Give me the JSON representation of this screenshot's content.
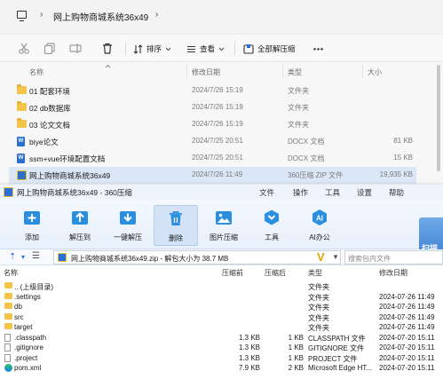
{
  "explorer": {
    "breadcrumb_chevron": "›",
    "folder_name": "网上购物商城系统36x49",
    "toolbar": {
      "sort_label": "排序",
      "view_label": "查看",
      "extract_all_label": "全部解压缩",
      "more_label": "•••"
    },
    "columns": {
      "name": "名称",
      "date": "修改日期",
      "type": "类型",
      "size": "大小"
    },
    "files": [
      {
        "name": "01 配套环境",
        "date": "2024/7/26 15:19",
        "type": "文件夹",
        "size": "",
        "icon": "folder-icon"
      },
      {
        "name": "02 db数据库",
        "date": "2024/7/26 15:19",
        "type": "文件夹",
        "size": "",
        "icon": "folder-icon"
      },
      {
        "name": "03 论文文档",
        "date": "2024/7/26 15:19",
        "type": "文件夹",
        "size": "",
        "icon": "folder-icon"
      },
      {
        "name": "biye论文",
        "date": "2024/7/25 20:51",
        "type": "DOCX 文档",
        "size": "81 KB",
        "icon": "docx-icon"
      },
      {
        "name": "ssm+vue环境配置文档",
        "date": "2024/7/25 20:51",
        "type": "DOCX 文档",
        "size": "15 KB",
        "icon": "docx-icon"
      },
      {
        "name": "网上购物商城系统36x49",
        "date": "2024/7/26 11:49",
        "type": "360压缩 ZIP 文件",
        "size": "19,935 KB",
        "icon": "zip-icon"
      }
    ]
  },
  "zip": {
    "title": "网上购物商城系统36x49 - 360压缩",
    "menu": [
      "文件",
      "操作",
      "工具",
      "设置",
      "帮助"
    ],
    "ribbon": [
      {
        "label": "添加",
        "icon": "add-icon"
      },
      {
        "label": "解压到",
        "icon": "extract-to-icon"
      },
      {
        "label": "一键解压",
        "icon": "one-click-extract-icon"
      },
      {
        "label": "删除",
        "icon": "delete-icon"
      },
      {
        "label": "图片压缩",
        "icon": "image-compress-icon"
      },
      {
        "label": "工具",
        "icon": "tools-icon"
      },
      {
        "label": "AI办公",
        "icon": "ai-office-icon"
      }
    ],
    "ai_badge": "AI",
    "tooltip": "删除",
    "scan_label": "扫描",
    "path": "网上购物商城系统36x49.zip - 解包大小为 38.7 MB",
    "path_v": "V",
    "search_placeholder": "搜索包内文件",
    "columns": {
      "name": "名称",
      "compressed": "压缩前",
      "original": "压缩后",
      "type": "类型",
      "date": "修改日期"
    },
    "rows": [
      {
        "name": ".. (上级目录)",
        "compressed": "",
        "original": "",
        "type": "文件夹",
        "date": "",
        "kind": "folder"
      },
      {
        "name": ".settings",
        "compressed": "",
        "original": "",
        "type": "文件夹",
        "date": "2024-07-26 11:49",
        "kind": "folder"
      },
      {
        "name": "db",
        "compressed": "",
        "original": "",
        "type": "文件夹",
        "date": "2024-07-26 11:49",
        "kind": "folder"
      },
      {
        "name": "src",
        "compressed": "",
        "original": "",
        "type": "文件夹",
        "date": "2024-07-26 11:49",
        "kind": "folder"
      },
      {
        "name": "target",
        "compressed": "",
        "original": "",
        "type": "文件夹",
        "date": "2024-07-26 11:49",
        "kind": "folder"
      },
      {
        "name": ".classpath",
        "compressed": "1.3 KB",
        "original": "1 KB",
        "type": "CLASSPATH 文件",
        "date": "2024-07-20 15:11",
        "kind": "file"
      },
      {
        "name": ".gitignore",
        "compressed": "1.3 KB",
        "original": "1 KB",
        "type": "GITIGNORE 文件",
        "date": "2024-07-20 15:11",
        "kind": "file"
      },
      {
        "name": ".project",
        "compressed": "1.3 KB",
        "original": "1 KB",
        "type": "PROJECT 文件",
        "date": "2024-07-20 15:11",
        "kind": "file"
      },
      {
        "name": "pom.xml",
        "compressed": "7.9 KB",
        "original": "2 KB",
        "type": "Microsoft Edge HT...",
        "date": "2024-07-20 15:11",
        "kind": "edge"
      }
    ]
  }
}
